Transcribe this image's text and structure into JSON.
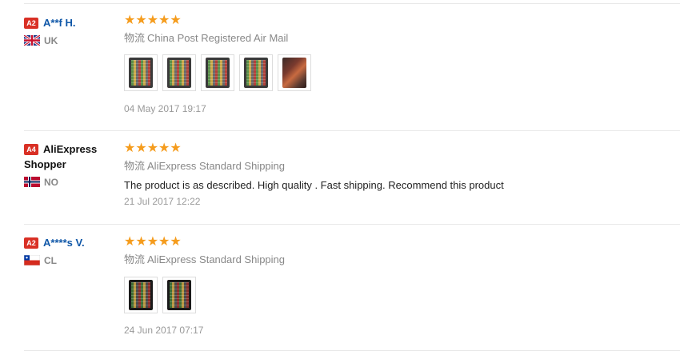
{
  "reviews": [
    {
      "badge": "A2",
      "name": "A**f H.",
      "country": "UK",
      "flag": "uk-flag",
      "stars": "★★★★★",
      "logistics_cn": "物流",
      "logistics": "China Post Registered Air Mail",
      "photo_count": 5,
      "date": "04 May 2017 19:17"
    },
    {
      "badge": "A4",
      "name": "AliExpress Shopper",
      "country": "NO",
      "flag": "norway-flag",
      "stars": "★★★★★",
      "logistics_cn": "物流",
      "logistics": "AliExpress Standard Shipping",
      "text": "The product is as described. High quality . Fast shipping. Recommend this product",
      "date": "21 Jul 2017 12:22"
    },
    {
      "badge": "A2",
      "name": "A****s V.",
      "country": "CL",
      "flag": "chile-flag",
      "stars": "★★★★★",
      "logistics_cn": "物流",
      "logistics": "AliExpress Standard Shipping",
      "photo_count": 2,
      "date": "24 Jun 2017 07:17"
    }
  ],
  "colors": {
    "star": "#f59c1d",
    "badge": "#d93025",
    "username": "#0f57a8",
    "meta": "#888888"
  }
}
